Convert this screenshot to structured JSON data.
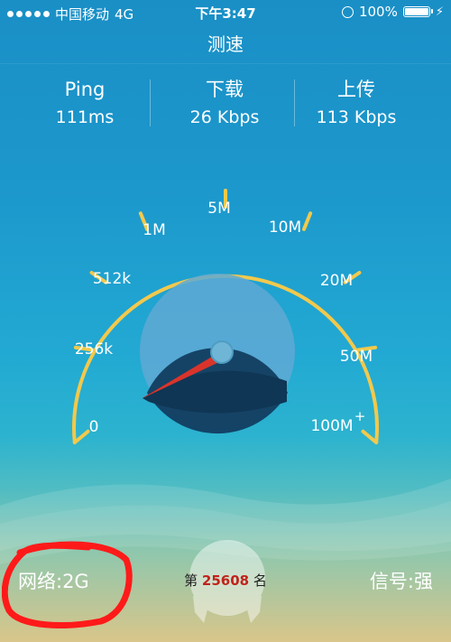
{
  "status_bar": {
    "carrier": "中国移动",
    "network": "4G",
    "time": "下午3:47",
    "battery": "100%",
    "signal_dots": 5
  },
  "nav": {
    "title": "测速"
  },
  "stats": [
    {
      "label": "Ping",
      "value": "111ms"
    },
    {
      "label": "下载",
      "value": "26 Kbps"
    },
    {
      "label": "上传",
      "value": "113 Kbps"
    }
  ],
  "gauge": {
    "ticks": [
      "0",
      "256k",
      "512k",
      "1M",
      "5M",
      "10M",
      "20M",
      "50M",
      "100M"
    ],
    "max_plus": "+"
  },
  "footer": {
    "network_label": "网络:2G",
    "rank_prefix": "第",
    "rank_value": "25608",
    "rank_suffix": "名",
    "signal_label": "信号:强"
  },
  "colors": {
    "gauge_arc": "#f2c94c",
    "needle": "#d9342b",
    "rank_number": "#c0231b",
    "annotation_circle": "#ff1a1a"
  }
}
